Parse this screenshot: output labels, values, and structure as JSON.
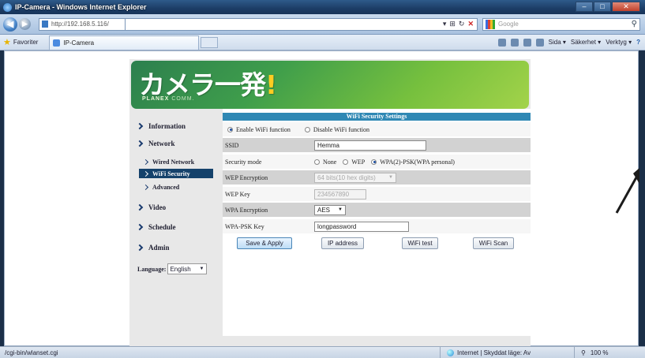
{
  "browser": {
    "window_title": "IP-Camera - Windows Internet Explorer",
    "address": "http://192.168.5.116/",
    "search_placeholder": "Google",
    "favorites_label": "Favoriter",
    "tab_title": "IP-Camera",
    "commands": [
      "Sida ▾",
      "Säkerhet ▾",
      "Verktyg ▾"
    ],
    "status_url": "/cgi-bin/wlanset.cgi",
    "status_zone": "Internet | Skyddat läge: Av",
    "zoom": "100 %"
  },
  "camera": {
    "logo_text": "カメラ一発",
    "logo_mark": "!",
    "brand": "PLANEX",
    "brand_suffix": "COMM.",
    "nav": {
      "information": "Information",
      "network": "Network",
      "wired_network": "Wired Network",
      "wifi_security": "WiFi Security",
      "advanced": "Advanced",
      "video": "Video",
      "schedule": "Schedule",
      "admin": "Admin"
    },
    "language_label": "Language:",
    "language_value": "English",
    "settings": {
      "title": "WiFi Security Settings",
      "enable_wifi": "Enable WiFi function",
      "disable_wifi": "Disable WiFi function",
      "wifi_enabled": true,
      "ssid_label": "SSID",
      "ssid_value": "Hemma",
      "security_label": "Security mode",
      "mode_none": "None",
      "mode_wep": "WEP",
      "mode_wpa": "WPA(2)-PSK(WPA personal)",
      "selected_mode": "WPA(2)-PSK(WPA personal)",
      "wep_enc_label": "WEP Encryption",
      "wep_enc_value": "64 bits(10 hex digits)",
      "wep_key_label": "WEP Key",
      "wep_key_value": "234567890",
      "wpa_enc_label": "WPA Encryption",
      "wpa_enc_value": "AES",
      "wpa_key_label": "WPA-PSK Key",
      "wpa_key_value": "longpassword"
    },
    "buttons": {
      "save": "Save & Apply",
      "ip": "IP address",
      "test": "WiFi test",
      "scan": "WiFi Scan"
    }
  }
}
